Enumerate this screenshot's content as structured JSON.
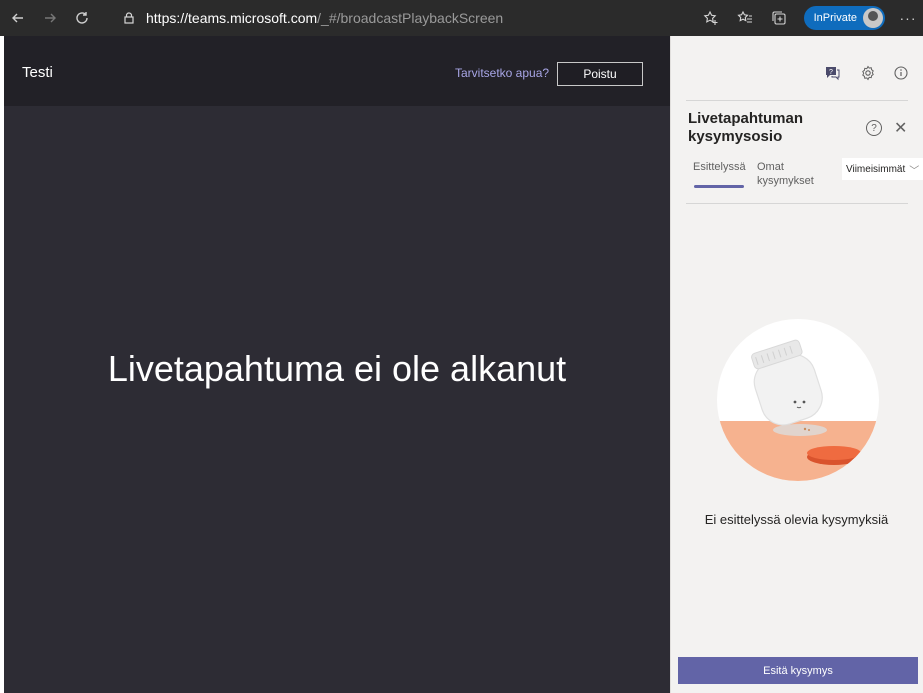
{
  "browser": {
    "url_host": "https://teams.microsoft.com",
    "url_path": "/_#/broadcastPlaybackScreen",
    "inprivate_label": "InPrivate",
    "more_label": "···"
  },
  "stage": {
    "event_title": "Testi",
    "help_link": "Tarvitsetko apua?",
    "leave_button": "Poistu",
    "message": "Livetapahtuma ei ole alkanut"
  },
  "qa_panel": {
    "title": "Livetapahtuman kysymysosio",
    "tabs": [
      {
        "label": "Esittelyssä",
        "active": true
      },
      {
        "label": "Omat kysymykset",
        "active": false
      }
    ],
    "sort_label": "Viimeisimmät",
    "empty_message": "Ei esittelyssä olevia kysymyksiä",
    "ask_button": "Esitä kysymys"
  },
  "colors": {
    "accent": "#6264a7",
    "stage_bg": "#2d2c34",
    "panel_bg": "#f3f2f1",
    "inprivate_badge": "#0f6cbd"
  },
  "icons": [
    "back-icon",
    "forward-icon",
    "refresh-icon",
    "lock-icon",
    "favorite-add-icon",
    "favorites-icon",
    "collections-icon",
    "profile-avatar",
    "more-icon",
    "qa-icon",
    "settings-icon",
    "info-icon",
    "help-icon",
    "close-icon",
    "chevron-down-icon"
  ]
}
